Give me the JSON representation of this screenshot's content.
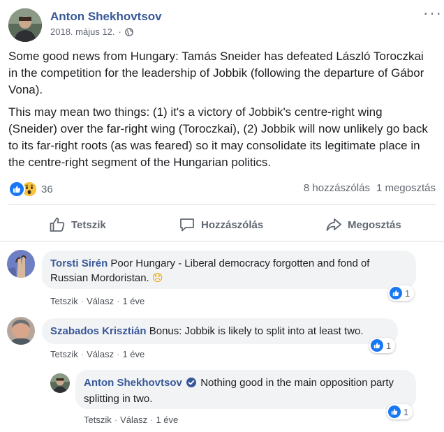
{
  "post": {
    "author": "Anton Shekhovtsov",
    "date": "2018. május 12.",
    "separator": "·",
    "paragraphs": [
      "Some good news from Hungary: Tamás Sneider has defeated László Toroczkai in the competition for the leadership of Jobbik (following the departure of Gábor Vona).",
      "This may mean two things: (1) it's a victory of Jobbik's centre-right wing (Sneider) over the far-right wing (Toroczkai), (2) Jobbik will now unlikely go back to its far-right roots (as was feared) so it may consolidate its legitimate place in the centre-right segment of the Hungarian politics."
    ],
    "more": "···",
    "reactions_count": "36",
    "comments_count": "8 hozzászólás",
    "shares_count": "1 megosztás"
  },
  "actions": {
    "like": "Tetszik",
    "comment": "Hozzászólás",
    "share": "Megosztás"
  },
  "comments": [
    {
      "name": "Torsti Sirén",
      "text": "Poor Hungary - Liberal democracy forgotten and fond of Russian Mordoristan.",
      "emoji": "😞",
      "like": "Tetszik",
      "reply": "Válasz",
      "time": "1 éve",
      "likes": "1"
    },
    {
      "name": "Szabados Krisztián",
      "text": "Bonus: Jobbik is likely to split into at least two.",
      "like": "Tetszik",
      "reply": "Válasz",
      "time": "1 éve",
      "likes": "1"
    },
    {
      "name": "Anton Shekhovtsov",
      "text": "Nothing good in the main opposition party splitting in two.",
      "like": "Tetszik",
      "reply": "Válasz",
      "time": "1 éve",
      "likes": "1"
    }
  ],
  "colors": {
    "link": "#385898",
    "like_blue": "#1877f2",
    "wow_yellow": "#f7c33b",
    "muted": "#606770",
    "bubble": "#f2f3f5"
  }
}
